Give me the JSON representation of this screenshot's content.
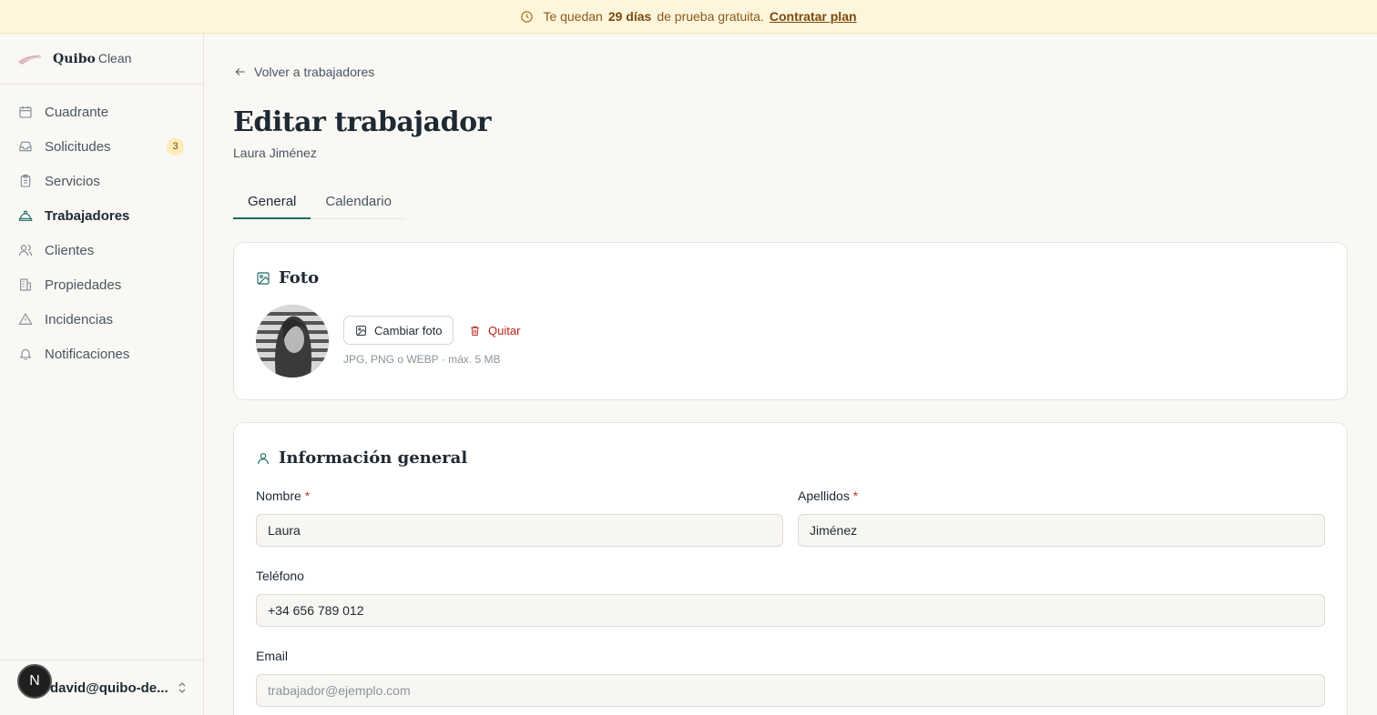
{
  "banner": {
    "prefix": "Te quedan",
    "days": "29 días",
    "suffix": "de prueba gratuita.",
    "cta": "Contratar plan"
  },
  "brand": {
    "name": "Quibo",
    "product": "Clean"
  },
  "sidebar": {
    "items": [
      {
        "label": "Cuadrante",
        "icon": "calendar-icon"
      },
      {
        "label": "Solicitudes",
        "icon": "inbox-icon",
        "badge": "3"
      },
      {
        "label": "Servicios",
        "icon": "clipboard-icon"
      },
      {
        "label": "Trabajadores",
        "icon": "hard-hat-icon",
        "active": true
      },
      {
        "label": "Clientes",
        "icon": "users-icon"
      },
      {
        "label": "Propiedades",
        "icon": "building-icon"
      },
      {
        "label": "Incidencias",
        "icon": "warning-triangle-icon"
      },
      {
        "label": "Notificaciones",
        "icon": "bell-icon"
      }
    ],
    "user": {
      "initial": "N",
      "email": "david@quibo-de..."
    }
  },
  "page": {
    "back_label": "Volver a trabajadores",
    "title": "Editar trabajador",
    "subtitle": "Laura Jiménez",
    "tabs": [
      {
        "label": "General",
        "active": true
      },
      {
        "label": "Calendario"
      }
    ]
  },
  "photo_card": {
    "title": "Foto",
    "change_label": "Cambiar foto",
    "remove_label": "Quitar",
    "hint": "JPG, PNG o WEBP · máx. 5 MB"
  },
  "info_card": {
    "title": "Información general",
    "fields": {
      "first_name": {
        "label": "Nombre",
        "required": "*",
        "value": "Laura"
      },
      "last_name": {
        "label": "Apellidos",
        "required": "*",
        "value": "Jiménez"
      },
      "phone": {
        "label": "Teléfono",
        "value": "+34 656 789 012"
      },
      "email": {
        "label": "Email",
        "value": "",
        "placeholder": "trabajador@ejemplo.com"
      }
    }
  },
  "colors": {
    "accent": "#1d6b63",
    "banner_bg": "#fdf5dc",
    "danger": "#b42318",
    "badge_bg": "#fbecb8"
  }
}
